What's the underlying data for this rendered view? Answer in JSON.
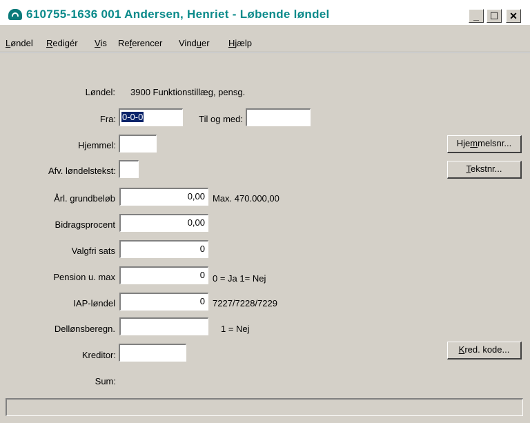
{
  "window": {
    "title": "610755-1636 001 Andersen, Henriet - Løbende løndel",
    "minimize": "_",
    "maximize": "☐",
    "close": "✕"
  },
  "menu": [
    {
      "label": "Løndel",
      "accel": "L"
    },
    {
      "label": "Redigér",
      "accel": "R"
    },
    {
      "label": "Vis",
      "accel": "V"
    },
    {
      "label": "Referencer",
      "accel": "f"
    },
    {
      "label": "Vinduer",
      "accel": "u"
    },
    {
      "label": "Hjælp",
      "accel": "H"
    }
  ],
  "form": {
    "loendel_label": "Løndel:",
    "loendel_value": "3900  Funktionstillæg, pensg.",
    "fra_label": "Fra:",
    "fra_value": "0-0-0",
    "til_label": "Til og med:",
    "til_value": "",
    "hjemmel_label": "Hjemmel:",
    "hjemmel_value": "",
    "afv_label": "Afv. løndelstekst:",
    "afv_value": "",
    "grund_label": "Årl. grundbeløb",
    "grund_value": "0,00",
    "grund_note": "Max. 470.000,00",
    "bidrag_label": "Bidragsprocent",
    "bidrag_value": "0,00",
    "valgfri_label": "Valgfri sats",
    "valgfri_value": "0",
    "pension_label": "Pension u. max",
    "pension_value": "0",
    "pension_note": "0 = Ja 1= Nej",
    "iap_label": "IAP-løndel",
    "iap_value": "0",
    "iap_note": "7227/7228/7229",
    "dellon_label": "Dellønsberegn.",
    "dellon_value": "",
    "dellon_note": "1 = Nej",
    "kreditor_label": "Kreditor:",
    "kreditor_value": "",
    "sum_label": "Sum:"
  },
  "buttons": {
    "hjemmelsnr_pre": "Hje",
    "hjemmelsnr_accel": "m",
    "hjemmelsnr_post": "melsnr...",
    "tekstnr_accel": "T",
    "tekstnr_post": "ekstnr...",
    "kred_accel": "K",
    "kred_post": "red. kode..."
  },
  "status": {
    "text": ""
  }
}
